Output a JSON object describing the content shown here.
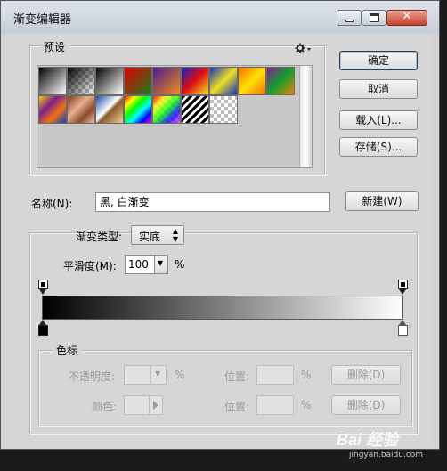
{
  "window": {
    "title": "渐变编辑器"
  },
  "buttons": {
    "ok": "确定",
    "cancel": "取消",
    "load": "载入(L)...",
    "save": "存储(S)...",
    "new": "新建(W)",
    "delete_opacity": "删除(D)",
    "delete_color": "删除(D)"
  },
  "presets": {
    "legend": "预设",
    "menu_icon": "gear-icon",
    "items": [
      {
        "name": "foreground-to-background",
        "css": "linear-gradient(135deg,#000 0%,#fff 100%)"
      },
      {
        "name": "foreground-to-transparent",
        "css": "linear-gradient(135deg,#000 0%,rgba(0,0,0,0) 100%)",
        "checker": true
      },
      {
        "name": "black-white",
        "css": "linear-gradient(135deg,#000 0%,#fff 100%)"
      },
      {
        "name": "red-green",
        "css": "linear-gradient(135deg,#e00000 0%,#1e7a1e 100%)"
      },
      {
        "name": "violet-orange",
        "css": "linear-gradient(135deg,#4a1a8a 0%,#f0901a 100%)"
      },
      {
        "name": "blue-red-yellow",
        "css": "linear-gradient(135deg,#1020c0 0%,#e01010 50%,#f0e020 100%)"
      },
      {
        "name": "blue-yellow-blue",
        "css": "linear-gradient(135deg,#1030c0 0%,#f0e020 50%,#1030c0 100%)"
      },
      {
        "name": "orange-yellow-orange",
        "css": "linear-gradient(135deg,#f07000 0%,#ffe000 50%,#f07000 100%)"
      },
      {
        "name": "violet-green-orange",
        "css": "linear-gradient(135deg,#8a1a8a 0%,#10a030 50%,#f08000 100%)"
      },
      {
        "name": "yellow-violet-orange-blue",
        "css": "linear-gradient(135deg,#f0d000 0%,#7a2090 35%,#f07010 65%,#1040c0 100%)"
      },
      {
        "name": "copper",
        "css": "linear-gradient(135deg,#7a3a1a 0%,#e8b090 40%,#8a4a2a 70%,#f0c0a0 100%)"
      },
      {
        "name": "chrome",
        "css": "linear-gradient(135deg,#1a4aa0 0%,#ffffff 45%,#8a5a2a 55%,#f0d090 100%)"
      },
      {
        "name": "spectrum",
        "css": "linear-gradient(135deg,#ff0000 0%,#ffff00 20%,#00ff00 40%,#00ffff 60%,#0000ff 80%,#ff00ff 100%)"
      },
      {
        "name": "transparent-rainbow",
        "css": "linear-gradient(135deg,rgba(255,0,0,0.9) 0%,rgba(255,255,0,0.8) 25%,rgba(0,255,0,0.8) 50%,rgba(0,0,255,0.8) 75%,rgba(255,0,255,0.6) 100%)",
        "checker": true
      },
      {
        "name": "transparent-stripes",
        "css": "repeating-linear-gradient(135deg,#000 0px,#000 3px,#fff 3px,#fff 6px)"
      },
      {
        "name": "transparent-checker",
        "css": "none",
        "checker": true
      }
    ]
  },
  "name_row": {
    "label": "名称(N):",
    "value": "黑, 白渐变"
  },
  "gradient": {
    "type_label": "渐变类型:",
    "type_value": "实底",
    "smooth_label": "平滑度(M):",
    "smooth_value": "100",
    "smooth_unit": "%",
    "colors": [
      "#000000",
      "#ffffff"
    ]
  },
  "stops": {
    "legend": "色标",
    "opacity_label": "不透明度:",
    "opacity_unit": "%",
    "opacity_position_label": "位置:",
    "opacity_position_unit": "%",
    "color_label": "颜色:",
    "color_position_label": "位置:",
    "color_position_unit": "%"
  },
  "watermark": {
    "text": "Bai 经验",
    "sub": "jingyan.baidu.com"
  }
}
